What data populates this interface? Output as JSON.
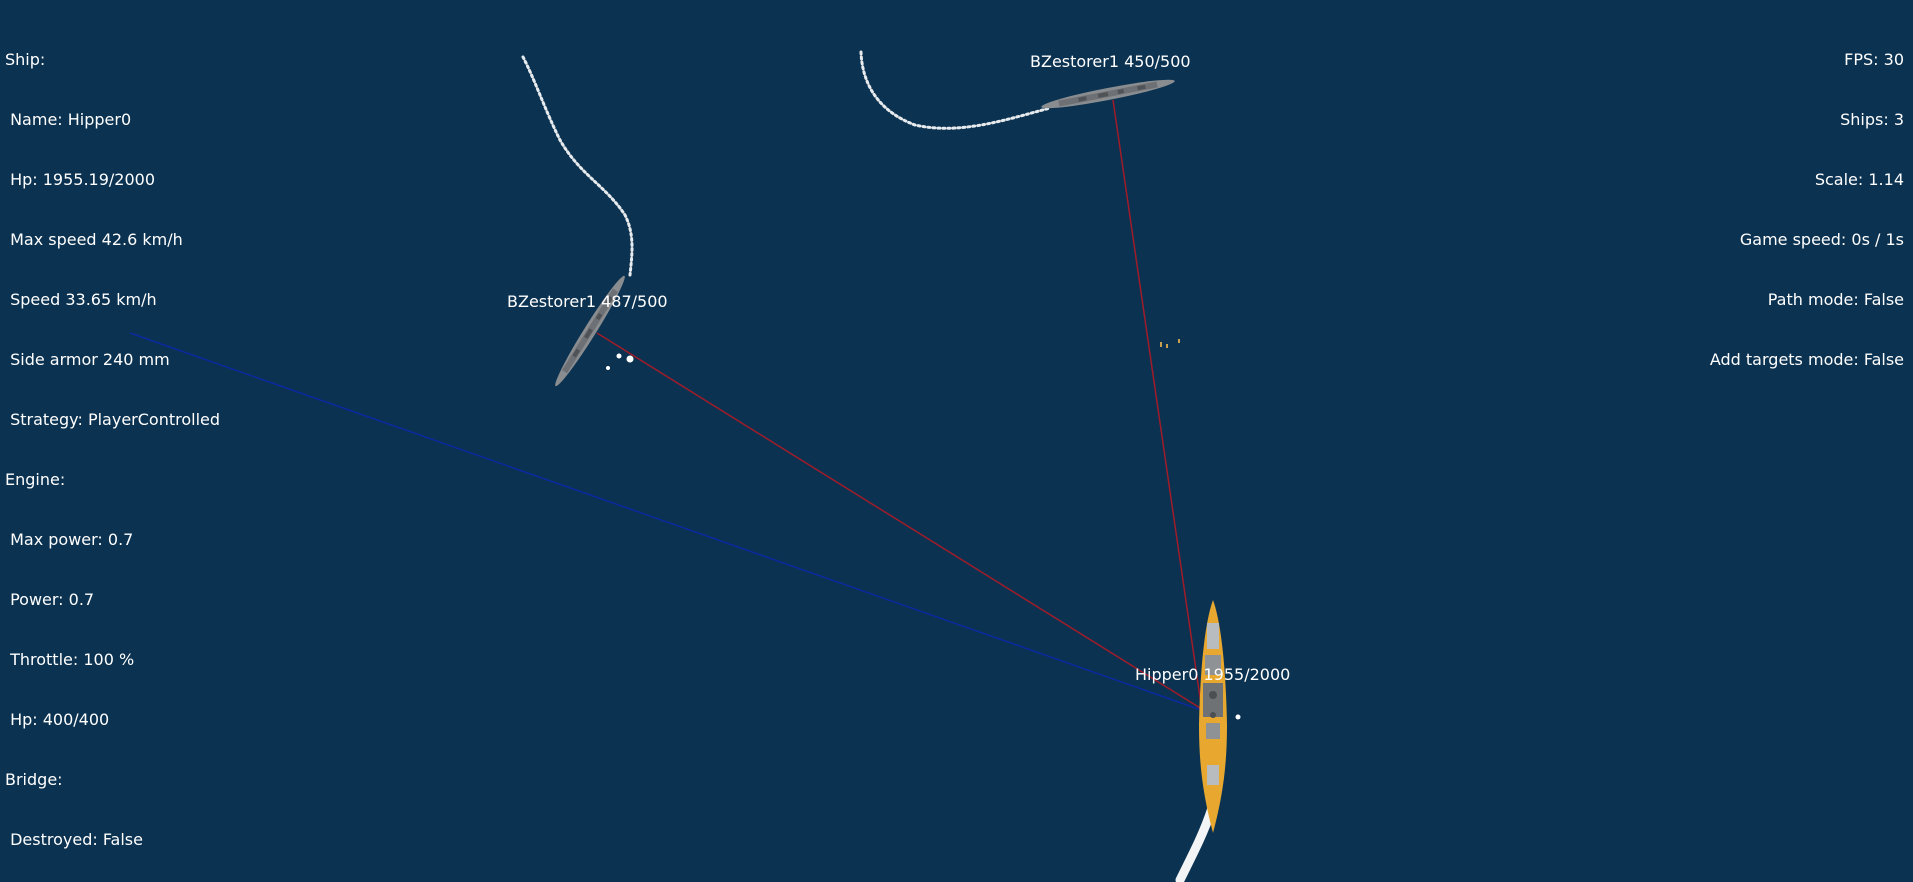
{
  "hud_left": [
    "Ship:",
    " Name: Hipper0",
    " Hp: 1955.19/2000",
    " Max speed 42.6 km/h",
    " Speed 33.65 km/h",
    " Side armor 240 mm",
    " Strategy: PlayerControlled",
    "Engine:",
    " Max power: 0.7",
    " Power: 0.7",
    " Throttle: 100 %",
    " Hp: 400/400",
    "Bridge:",
    " Destroyed: False"
  ],
  "hud_right": [
    "FPS: 30",
    "Ships: 3",
    "Scale: 1.14",
    "Game speed: 0s / 1s",
    "Path mode: False",
    "Add targets mode: False"
  ],
  "ships": {
    "destroyer_top": {
      "label": "BZestorer1 450/500"
    },
    "destroyer_left": {
      "label": "BZestorer1 487/500"
    },
    "hipper": {
      "label": "Hipper0 1955/2000"
    }
  },
  "colors": {
    "sea": "#0b3251",
    "target_line": "#a01c2a",
    "aim_line": "#0a2aa0",
    "wake": "#ffffff",
    "destroyer_hull": "#8a8d90",
    "hipper_hull": "#e8a830"
  }
}
